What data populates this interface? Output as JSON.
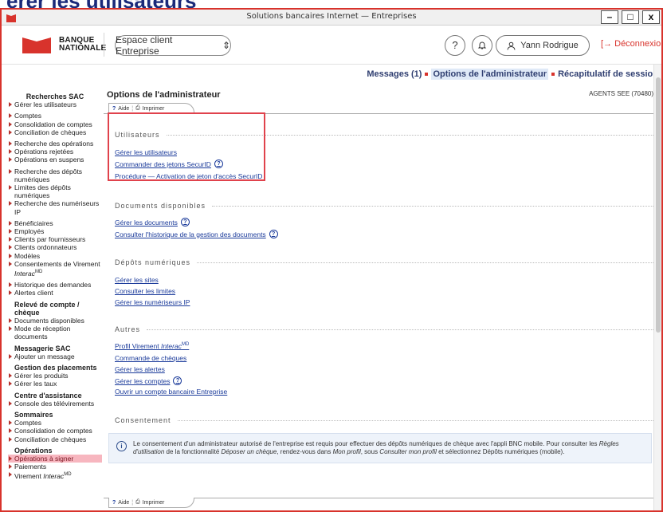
{
  "heading": "érer les utilisateurs",
  "window": {
    "title": "Solutions bancaires Internet — Entreprises",
    "buttons": [
      "–",
      "□",
      "x"
    ]
  },
  "header": {
    "brand_line1": "BANQUE",
    "brand_line2": "NATIONALE",
    "space_select": "Espace client Entreprise",
    "help_icon": "?",
    "user_name": "Yann Rodrigue",
    "logout": "Déconnexion"
  },
  "topnav": {
    "messages": "Messages (1)",
    "admin": "Options de l'administrateur",
    "recap": "Récapitulatif de session"
  },
  "sidebar": {
    "recherches_head": "Recherches SAC",
    "recherches": [
      "Gérer les utilisateurs"
    ],
    "group1": [
      "Comptes",
      "Consolidation de comptes",
      "Conciliation de chèques"
    ],
    "group2": [
      "Recherche des opérations",
      "Opérations rejetées",
      "Opérations en suspens"
    ],
    "group3": [
      "Recherche des dépôts numériques",
      "Limites des dépôts numériques",
      "Recherche des numériseurs IP"
    ],
    "group4": [
      "Bénéficiaires",
      "Employés",
      "Clients par fournisseurs",
      "Clients ordonnateurs",
      "Modèles"
    ],
    "consentements": "Consentements de Virement ",
    "interac": "Interac",
    "md": "MD",
    "group5": [
      "Historique des demandes",
      "Alertes client"
    ],
    "releve_head": "Relevé de compte / chèque",
    "releve": [
      "Documents disponibles",
      "Mode de réception documents"
    ],
    "messagerie_head": "Messagerie SAC",
    "messagerie": [
      "Ajouter un message"
    ],
    "placements_head": "Gestion des placements",
    "placements": [
      "Gérer les produits",
      "Gérer les taux"
    ],
    "assistance_head": "Centre d'assistance",
    "assistance": [
      "Console des télévirements"
    ],
    "sommaires_head": "Sommaires",
    "sommaires": [
      "Comptes",
      "Consolidation de comptes",
      "Conciliation de chèques"
    ],
    "operations_head": "Opérations",
    "operations_active": "Opérations à signer",
    "operations": [
      "Paiements"
    ],
    "virement": "Virement "
  },
  "main": {
    "title": "Options de l'administrateur",
    "agents": "AGENTS SEE (70480)",
    "tab_aide": "Aide",
    "tab_imprimer": "Imprimer",
    "sec_utilisateurs": "Utilisateurs",
    "link_gerer_utilisateurs": "Gérer les utilisateurs",
    "link_commander_jetons": "Commander des jetons SecurID",
    "link_procedure": "Procédure — Activation de jeton d'accès SecurID",
    "sec_documents": "Documents disponibles",
    "link_gerer_documents": "Gérer les documents",
    "link_historique": "Consulter l'historique de la gestion des documents",
    "sec_depots": "Dépôts numériques",
    "link_sites": "Gérer les sites",
    "link_limites": "Consulter les limites",
    "link_numeriseurs": "Gérer les numériseurs IP",
    "sec_autres": "Autres",
    "link_profil": "Profil Virement ",
    "link_cheques": "Commande de chèques",
    "link_alertes": "Gérer les alertes",
    "link_comptes": "Gérer les comptes",
    "link_ouvrir": "Ouvrir un compte bancaire Entreprise",
    "sec_consentement": "Consentement",
    "notice_1": "Le consentement d'un administrateur autorisé de l'entreprise est requis pour effectuer des dépôts numériques de chèque avec l'appli BNC mobile. Pour consulter les ",
    "notice_regles": "Règles d'utilisation",
    "notice_2": " de la fonctionnalité ",
    "notice_deposer": "Déposer un chèque",
    "notice_3": ", rendez-vous dans ",
    "notice_monprofil": "Mon profil",
    "notice_4": ", sous ",
    "notice_consulter": "Consulter mon profil",
    "notice_5": " et sélectionnez Dépôts numériques (mobile)."
  },
  "colors": {
    "brand_red": "#d8332c",
    "link_blue": "#1a3a9a",
    "nav_blue": "#2f3e70"
  }
}
